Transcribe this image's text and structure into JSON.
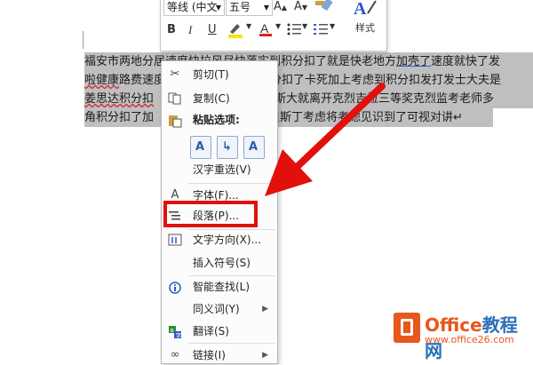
{
  "toolbar": {
    "font_name": "等线 (中文",
    "font_size": "五号",
    "style_label": "样式",
    "colors": {
      "highlight": "#f5e21a",
      "font_color": "#d4242a"
    }
  },
  "document": {
    "lines": [
      [
        "福安市两地分居速度快拉风尽快落实到积分扣了就是快老地方",
        "加壳了",
        "速度就快了发"
      ],
      [
        "啦健康",
        "路费速度",
        "",
        "",
        "分扣了卡死加上考虑到积分扣发打发士大夫是"
      ],
      [
        "姜思达积分扣",
        "",
        "",
        "克里斯大就离开克烈吉拉三等奖克烈监考老师多"
      ],
      [
        "角积分扣了加",
        "克里斯丁考虑将考虑见识到了可视对讲↵"
      ]
    ]
  },
  "context_menu": {
    "items": [
      {
        "label": "剪切(T)",
        "icon": "scissors-icon"
      },
      {
        "label": "复制(C)",
        "icon": "copy-icon"
      },
      {
        "label": "粘贴选项:",
        "icon": "paste-icon"
      },
      {
        "label": "汉字重选(V)",
        "icon": ""
      },
      {
        "label": "字体(F)...",
        "icon": "font-icon"
      },
      {
        "label": "段落(P)...",
        "icon": "paragraph-icon"
      },
      {
        "label": "文字方向(X)...",
        "icon": "text-direction-icon"
      },
      {
        "label": "插入符号(S)",
        "icon": ""
      },
      {
        "label": "智能查找(L)",
        "icon": "smart-lookup-icon"
      },
      {
        "label": "同义词(Y)",
        "icon": ""
      },
      {
        "label": "翻译(S)",
        "icon": "translate-icon"
      },
      {
        "label": "链接(I)",
        "icon": "link-icon"
      }
    ],
    "paste_options": [
      "keep-source-formatting",
      "merge-formatting",
      "keep-text-only"
    ]
  },
  "annotation": {
    "arrow_color": "#e2100c",
    "box_color": "#e2100c"
  },
  "watermark": {
    "brand_a": "Office",
    "brand_b": "教程网",
    "url": "www.office26.com"
  }
}
